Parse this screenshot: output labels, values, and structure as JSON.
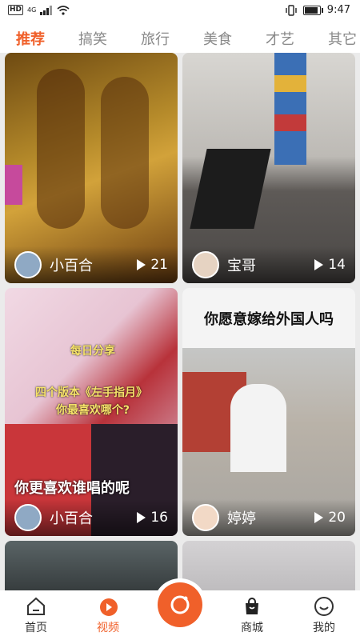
{
  "status": {
    "network_badge": "HD",
    "signal": "4G",
    "time": "9:47"
  },
  "tabs": [
    {
      "label": "推荐",
      "active": true
    },
    {
      "label": "搞笑"
    },
    {
      "label": "旅行"
    },
    {
      "label": "美食"
    },
    {
      "label": "才艺"
    },
    {
      "label": "其它"
    }
  ],
  "feed": [
    {
      "author": "小百合",
      "plays": "21"
    },
    {
      "author": "宝哥",
      "plays": "14"
    },
    {
      "author": "小百合",
      "plays": "16",
      "caption": "你更喜欢谁唱的呢",
      "overlay_1": "每日分享",
      "overlay_2": "四个版本《左手指月》",
      "overlay_3": "你最喜欢哪个?"
    },
    {
      "author": "婷婷",
      "plays": "20",
      "title": "你愿意嫁给外国人吗"
    }
  ],
  "tabbar": [
    {
      "label": "首页",
      "icon": "home-icon"
    },
    {
      "label": "视频",
      "icon": "video-icon",
      "active": true
    },
    {
      "label": "",
      "icon": "camera-icon"
    },
    {
      "label": "商城",
      "icon": "shopping-bag-icon"
    },
    {
      "label": "我的",
      "icon": "profile-icon"
    }
  ],
  "colors": {
    "accent": "#f0602a"
  }
}
